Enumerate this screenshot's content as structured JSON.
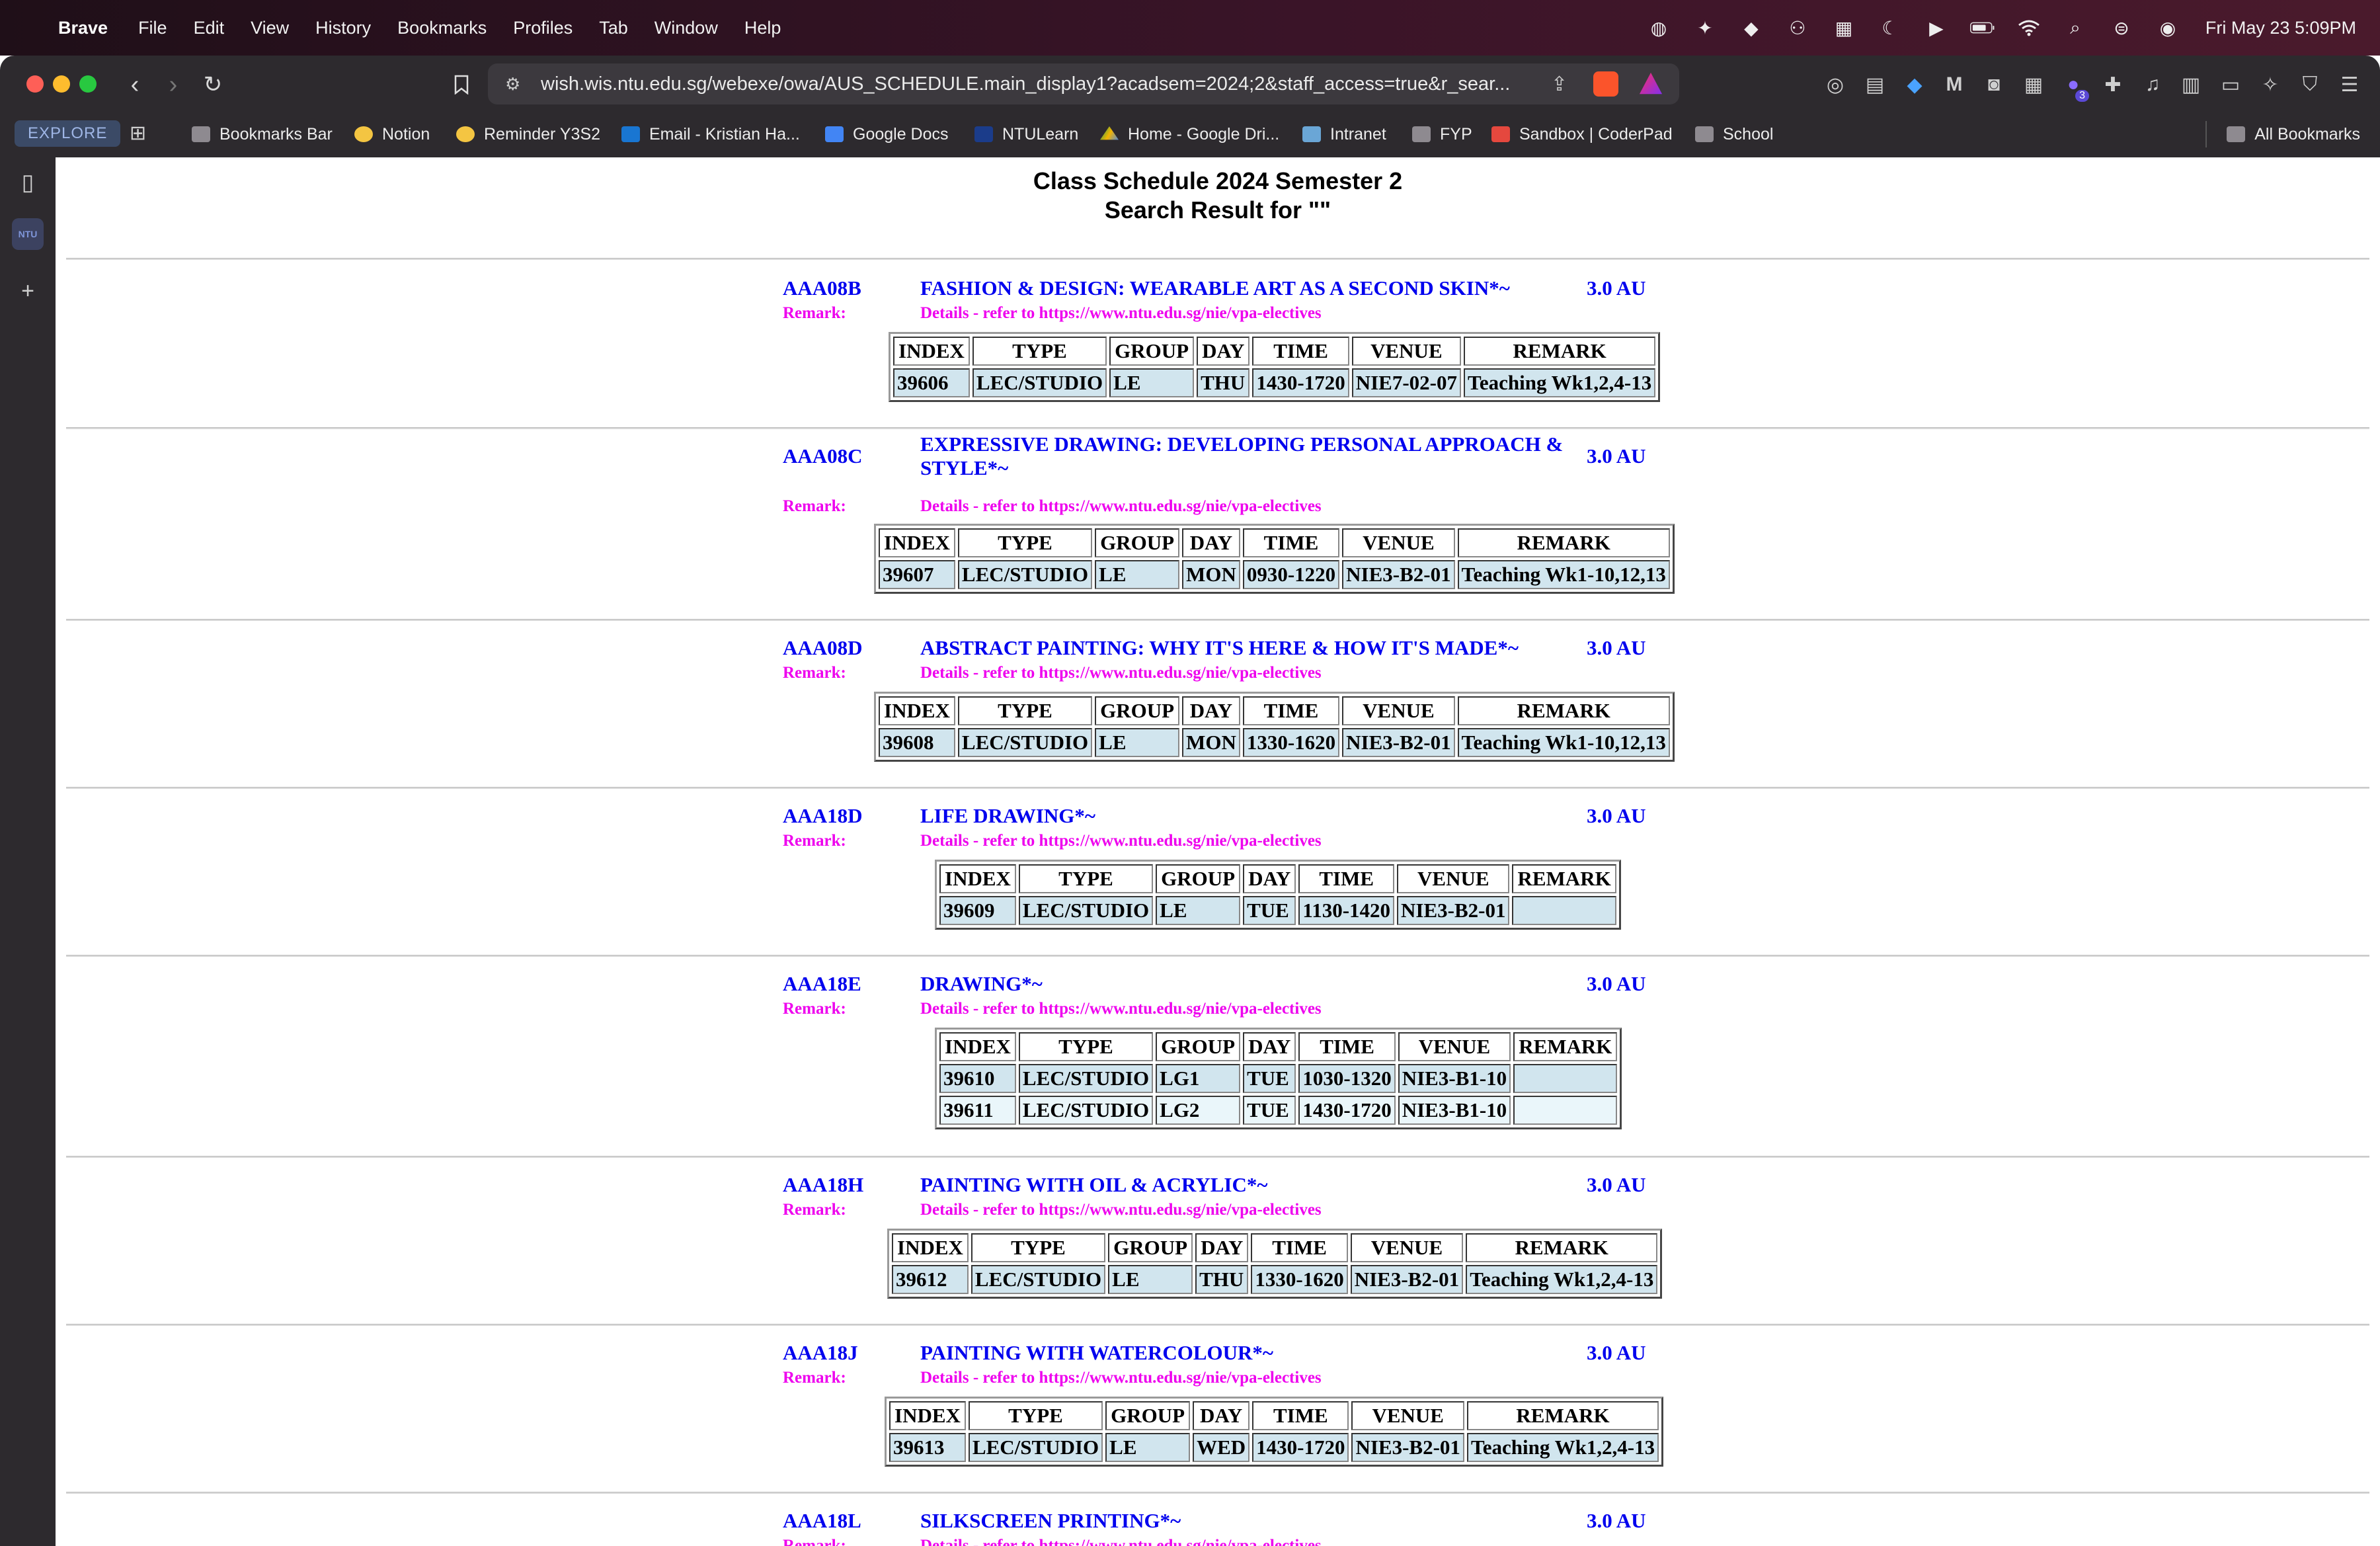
{
  "menubar": {
    "app_name": "Brave",
    "menus": [
      "File",
      "Edit",
      "View",
      "History",
      "Bookmarks",
      "Profiles",
      "Tab",
      "Window",
      "Help"
    ],
    "clock": "Fri May 23  5:09PM"
  },
  "browser": {
    "url": "wish.wis.ntu.edu.sg/webexe/owa/AUS_SCHEDULE.main_display1?acadsem=2024;2&staff_access=true&r_sear...",
    "extension_badge": "3",
    "explore_label": "EXPLORE",
    "bookmarks": [
      {
        "label": "Bookmarks Bar",
        "icon": "folder-icon"
      },
      {
        "label": "Notion",
        "icon": "emoji-icon"
      },
      {
        "label": "Reminder Y3S2",
        "icon": "emoji-icon"
      },
      {
        "label": "Email - Kristian Ha...",
        "icon": "outlook-icon"
      },
      {
        "label": "Google Docs",
        "icon": "docs-icon"
      },
      {
        "label": "NTULearn",
        "icon": "ntulearn-icon"
      },
      {
        "label": "Home - Google Dri...",
        "icon": "drive-icon"
      },
      {
        "label": "Intranet",
        "icon": "intranet-icon"
      },
      {
        "label": "FYP",
        "icon": "folder-icon"
      },
      {
        "label": "Sandbox | CoderPad",
        "icon": "coderpad-icon"
      },
      {
        "label": "School",
        "icon": "folder-icon"
      }
    ],
    "all_bookmarks": "All Bookmarks",
    "sidebar_tab": "NTU"
  },
  "page": {
    "title_line1": "Class Schedule 2024 Semester 2",
    "title_line2": "Search Result for \"\"",
    "remark_label": "Remark:",
    "headers": [
      "INDEX",
      "TYPE",
      "GROUP",
      "DAY",
      "TIME",
      "VENUE",
      "REMARK"
    ],
    "courses": [
      {
        "code": "AAA08B",
        "title": "FASHION & DESIGN: WEARABLE ART AS A SECOND SKIN*~",
        "au": "3.0 AU",
        "remark": "Details - refer to https://www.ntu.edu.sg/nie/vpa-electives",
        "rows": [
          [
            "39606",
            "LEC/STUDIO",
            "LE",
            "THU",
            "1430-1720",
            "NIE7-02-07",
            "Teaching Wk1,2,4-13"
          ]
        ]
      },
      {
        "code": "AAA08C",
        "title": "EXPRESSIVE DRAWING: DEVELOPING PERSONAL APPROACH & STYLE*~",
        "au": "3.0 AU",
        "remark": "Details - refer to https://www.ntu.edu.sg/nie/vpa-electives",
        "rows": [
          [
            "39607",
            "LEC/STUDIO",
            "LE",
            "MON",
            "0930-1220",
            "NIE3-B2-01",
            "Teaching Wk1-10,12,13"
          ]
        ]
      },
      {
        "code": "AAA08D",
        "title": "ABSTRACT PAINTING: WHY IT'S HERE & HOW IT'S MADE*~",
        "au": "3.0 AU",
        "remark": "Details - refer to https://www.ntu.edu.sg/nie/vpa-electives",
        "rows": [
          [
            "39608",
            "LEC/STUDIO",
            "LE",
            "MON",
            "1330-1620",
            "NIE3-B2-01",
            "Teaching Wk1-10,12,13"
          ]
        ]
      },
      {
        "code": "AAA18D",
        "title": "LIFE DRAWING*~",
        "au": "3.0 AU",
        "remark": "Details - refer to https://www.ntu.edu.sg/nie/vpa-electives",
        "rows": [
          [
            "39609",
            "LEC/STUDIO",
            "LE",
            "TUE",
            "1130-1420",
            "NIE3-B2-01",
            ""
          ]
        ]
      },
      {
        "code": "AAA18E",
        "title": "DRAWING*~",
        "au": "3.0 AU",
        "remark": "Details - refer to https://www.ntu.edu.sg/nie/vpa-electives",
        "rows": [
          [
            "39610",
            "LEC/STUDIO",
            "LG1",
            "TUE",
            "1030-1320",
            "NIE3-B1-10",
            ""
          ],
          [
            "39611",
            "LEC/STUDIO",
            "LG2",
            "TUE",
            "1430-1720",
            "NIE3-B1-10",
            ""
          ]
        ]
      },
      {
        "code": "AAA18H",
        "title": "PAINTING WITH OIL & ACRYLIC*~",
        "au": "3.0 AU",
        "remark": "Details - refer to https://www.ntu.edu.sg/nie/vpa-electives",
        "rows": [
          [
            "39612",
            "LEC/STUDIO",
            "LE",
            "THU",
            "1330-1620",
            "NIE3-B2-01",
            "Teaching Wk1,2,4-13"
          ]
        ]
      },
      {
        "code": "AAA18J",
        "title": "PAINTING WITH WATERCOLOUR*~",
        "au": "3.0 AU",
        "remark": "Details - refer to https://www.ntu.edu.sg/nie/vpa-electives",
        "rows": [
          [
            "39613",
            "LEC/STUDIO",
            "LE",
            "WED",
            "1430-1720",
            "NIE3-B2-01",
            "Teaching Wk1,2,4-13"
          ]
        ]
      },
      {
        "code": "AAA18L",
        "title": "SILKSCREEN PRINTING*~",
        "au": "3.0 AU",
        "remark": "Details - refer to https://www.ntu.edu.sg/nie/vpa-electives",
        "rows": []
      }
    ]
  }
}
